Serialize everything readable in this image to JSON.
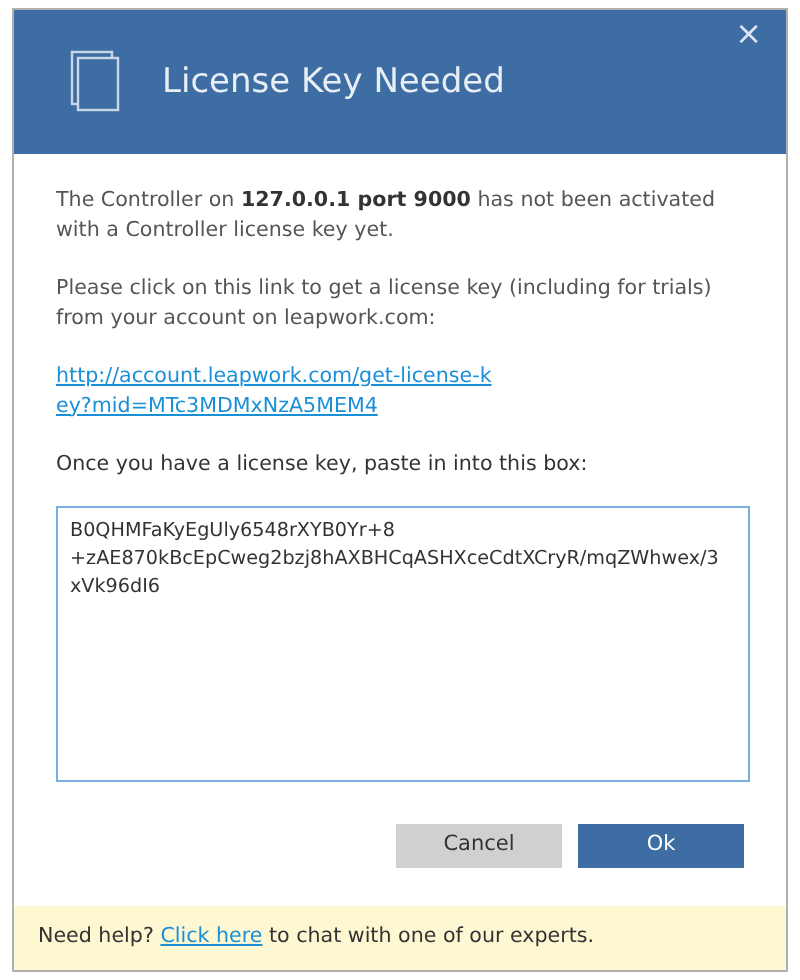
{
  "dialog": {
    "title": "License Key Needed",
    "close": "×"
  },
  "body": {
    "message": "The Controller on **127.0.0.1 port 9000** has not been activated with a Controller license key yet.",
    "instruction": "Please click on this link to get a license key (including for trials) from your account on leapwork.com:",
    "link": "http://account.leapwork.com/get-license-key?mid=MTc3MDMxNzA5MEM4",
    "paste_prompt": "Once you have a license key, paste in into this box:",
    "license_key": "B0QHMFaKyEgUly6548rXYB0Yr+8 +zAE870kBcEpCweg2bzj8hAXBHCqASHXceCdtXCryR/mqZWhwex/3 xVk96dI6"
  },
  "buttons": [
    {
      "label": "Cancel",
      "kind": "secondary"
    },
    {
      "label": "Ok",
      "kind": "primary"
    }
  ],
  "footer": {
    "before": "Need help?",
    "link": "Click here",
    "after": "to chat with one of our experts."
  }
}
